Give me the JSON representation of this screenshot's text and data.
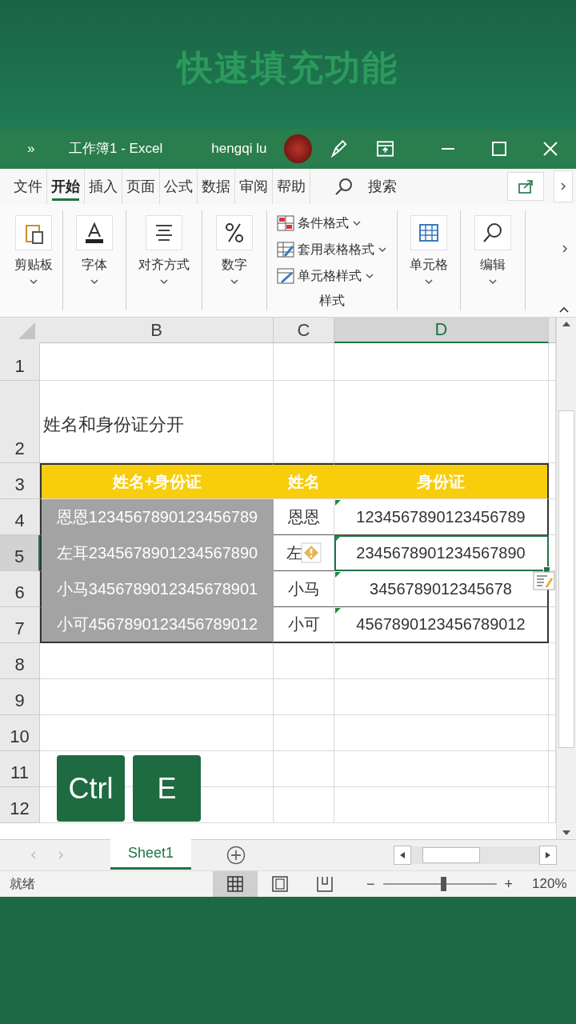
{
  "banner": {
    "title": "快速填充功能"
  },
  "title_bar": {
    "overflow": "»",
    "title": "工作簿1  -  Excel",
    "user": "hengqi lu"
  },
  "ribbon_tabs": [
    {
      "label": "文件",
      "selected": false
    },
    {
      "label": "开始",
      "selected": true
    },
    {
      "label": "插入",
      "selected": false
    },
    {
      "label": "页面",
      "selected": false
    },
    {
      "label": "公式",
      "selected": false
    },
    {
      "label": "数据",
      "selected": false
    },
    {
      "label": "审阅",
      "selected": false
    },
    {
      "label": "帮助",
      "selected": false
    }
  ],
  "search": {
    "label": "搜索"
  },
  "ribbon_groups": [
    {
      "kind": "big",
      "label": "剪贴板"
    },
    {
      "kind": "big",
      "label": "字体"
    },
    {
      "kind": "big",
      "label": "对齐方式"
    },
    {
      "kind": "big",
      "label": "数字"
    },
    {
      "kind": "list",
      "label": "样式",
      "items": [
        "条件格式",
        "套用表格格式",
        "单元格样式"
      ]
    },
    {
      "kind": "big",
      "label": "单元格"
    },
    {
      "kind": "big",
      "label": "编辑"
    }
  ],
  "columns": [
    {
      "label": "B",
      "selected": false
    },
    {
      "label": "C",
      "selected": false
    },
    {
      "label": "D",
      "selected": true
    }
  ],
  "rows": [
    {
      "number": "1",
      "selected": false,
      "cells": [
        {
          "kind": "plain"
        },
        {
          "kind": "plain"
        },
        {
          "kind": "plain"
        }
      ]
    },
    {
      "number": "2",
      "selected": false,
      "cells": [
        {
          "kind": "note",
          "text": "姓名和身份证分开"
        },
        {
          "kind": "plain"
        },
        {
          "kind": "plain"
        }
      ]
    },
    {
      "number": "3",
      "selected": false,
      "cells": [
        {
          "kind": "header",
          "text": "姓名+身份证"
        },
        {
          "kind": "header",
          "text": "姓名"
        },
        {
          "kind": "header",
          "text": "身份证"
        }
      ]
    },
    {
      "number": "4",
      "selected": false,
      "cells": [
        {
          "kind": "shaded",
          "text": "恩恩1234567890123456789"
        },
        {
          "kind": "data",
          "text": "恩恩"
        },
        {
          "kind": "data",
          "text": "1234567890123456789",
          "flag": true
        }
      ]
    },
    {
      "number": "5",
      "selected": true,
      "cells": [
        {
          "kind": "shaded",
          "text": "左耳2345678901234567890"
        },
        {
          "kind": "data",
          "text": "左",
          "warning": true
        },
        {
          "kind": "data",
          "text": "2345678901234567890",
          "flag": true,
          "active": true
        }
      ]
    },
    {
      "number": "6",
      "selected": false,
      "cells": [
        {
          "kind": "shaded",
          "text": "小马3456789012345678901"
        },
        {
          "kind": "data",
          "text": "小马"
        },
        {
          "kind": "data",
          "text": "3456789012345678",
          "flag": true,
          "fill_options": true
        }
      ]
    },
    {
      "number": "7",
      "selected": false,
      "cells": [
        {
          "kind": "shaded",
          "text": "小可4567890123456789012"
        },
        {
          "kind": "data",
          "text": "小可"
        },
        {
          "kind": "data",
          "text": "4567890123456789012",
          "flag": true
        }
      ]
    },
    {
      "number": "8",
      "selected": false,
      "cells": [
        {
          "kind": "plain"
        },
        {
          "kind": "plain"
        },
        {
          "kind": "plain"
        }
      ]
    },
    {
      "number": "9",
      "selected": false,
      "cells": [
        {
          "kind": "plain"
        },
        {
          "kind": "plain"
        },
        {
          "kind": "plain"
        }
      ]
    },
    {
      "number": "10",
      "selected": false,
      "cells": [
        {
          "kind": "plain"
        },
        {
          "kind": "plain"
        },
        {
          "kind": "plain"
        }
      ]
    },
    {
      "number": "11",
      "selected": false,
      "cells": [
        {
          "kind": "plain"
        },
        {
          "kind": "plain"
        },
        {
          "kind": "plain"
        }
      ]
    },
    {
      "number": "12",
      "selected": false,
      "cells": [
        {
          "kind": "plain"
        },
        {
          "kind": "plain"
        },
        {
          "kind": "plain"
        }
      ]
    }
  ],
  "keys": [
    "Ctrl",
    "E"
  ],
  "sheet_tabs": [
    {
      "label": "Sheet1",
      "selected": true
    }
  ],
  "status_bar": {
    "status": "就绪",
    "zoom_out": "−",
    "zoom_in": "+",
    "zoom": "120%",
    "zoom_slider": {
      "level": 0.53
    }
  }
}
